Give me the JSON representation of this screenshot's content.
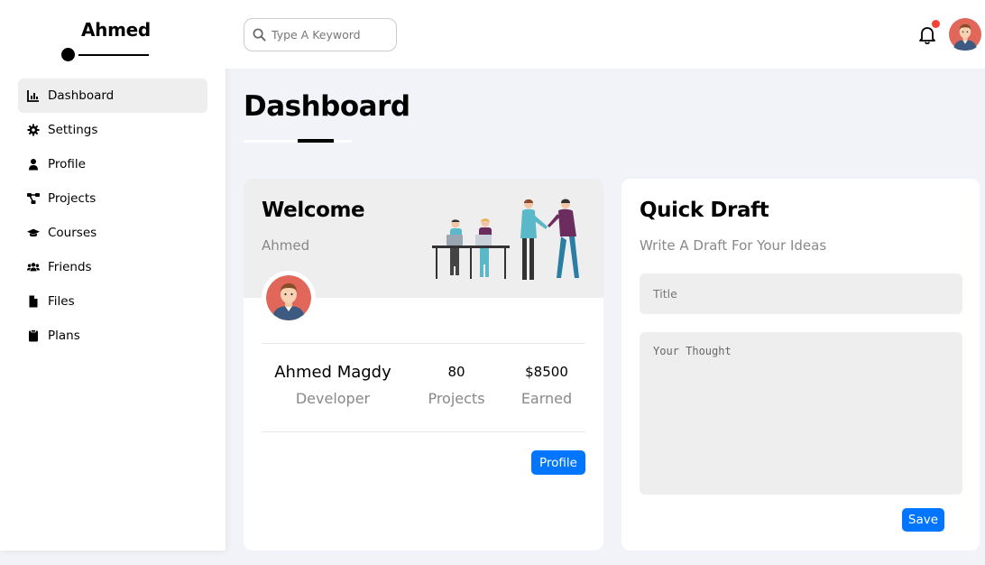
{
  "sidebar": {
    "brand": "Ahmed",
    "items": [
      {
        "label": "Dashboard",
        "icon": "chart-icon",
        "active": true
      },
      {
        "label": "Settings",
        "icon": "gear-icon"
      },
      {
        "label": "Profile",
        "icon": "user-icon"
      },
      {
        "label": "Projects",
        "icon": "diagram-icon"
      },
      {
        "label": "Courses",
        "icon": "graduation-cap-icon"
      },
      {
        "label": "Friends",
        "icon": "users-icon"
      },
      {
        "label": "Files",
        "icon": "file-icon"
      },
      {
        "label": "Plans",
        "icon": "clipboard-icon"
      }
    ]
  },
  "header": {
    "search_placeholder": "Type A Keyword",
    "notification_badge_color": "#f44336"
  },
  "page": {
    "title": "Dashboard"
  },
  "welcome": {
    "title": "Welcome",
    "name": "Ahmed",
    "full_name": "Ahmed Magdy",
    "role": "Developer",
    "projects_value": "80",
    "projects_label": "Projects",
    "earned_value": "$8500",
    "earned_label": "Earned",
    "profile_button": "Profile"
  },
  "draft": {
    "title": "Quick Draft",
    "subtitle": "Write A Draft For Your Ideas",
    "title_placeholder": "Title",
    "thought_placeholder": "Your Thought",
    "save_button": "Save"
  },
  "colors": {
    "accent": "#0075ff",
    "background": "#f1f3f8",
    "panel": "#eeeeee"
  }
}
